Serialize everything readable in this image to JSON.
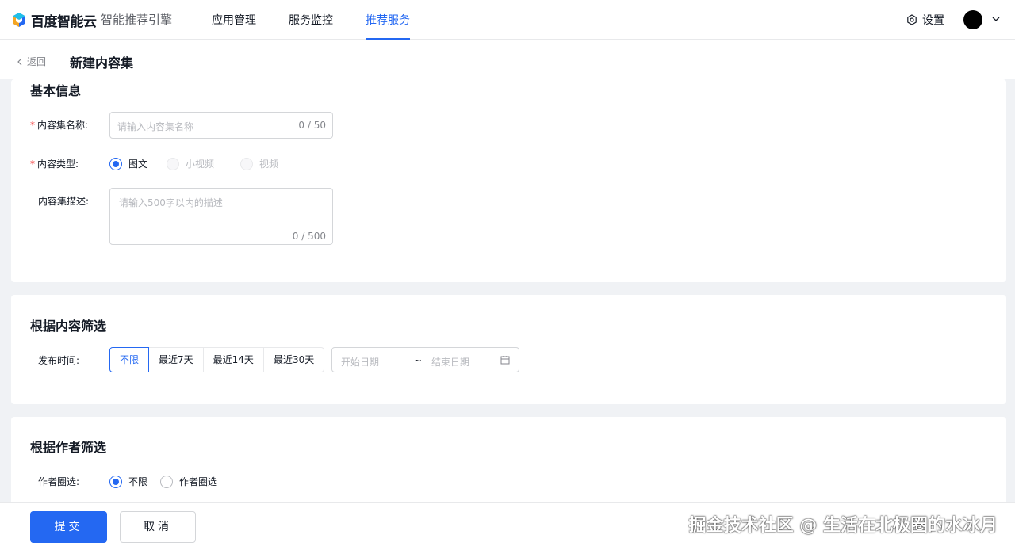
{
  "brand": {
    "logo_text": "百度智能云",
    "product_name": "智能推荐引擎"
  },
  "nav": {
    "items": [
      {
        "label": "应用管理",
        "active": false
      },
      {
        "label": "服务监控",
        "active": false
      },
      {
        "label": "推荐服务",
        "active": true
      }
    ],
    "settings_label": "设置"
  },
  "subheader": {
    "back_label": "返回",
    "title": "新建内容集"
  },
  "basic_info": {
    "title": "基本信息",
    "name_field": {
      "label": "内容集名称:",
      "required": true,
      "placeholder": "请输入内容集名称",
      "count": "0 / 50"
    },
    "type_field": {
      "label": "内容类型:",
      "required": true,
      "options": [
        {
          "label": "图文",
          "checked": true,
          "disabled": false
        },
        {
          "label": "小视频",
          "checked": false,
          "disabled": true
        },
        {
          "label": "视频",
          "checked": false,
          "disabled": true
        }
      ]
    },
    "desc_field": {
      "label": "内容集描述:",
      "required": false,
      "placeholder": "请输入500字以内的描述",
      "count": "0 / 500"
    }
  },
  "content_filter": {
    "title": "根据内容筛选",
    "publish_time_label": "发布时间:",
    "time_options": [
      "不限",
      "最近7天",
      "最近14天",
      "最近30天"
    ],
    "active_time_option": "不限",
    "start_placeholder": "开始日期",
    "separator": "~",
    "end_placeholder": "结束日期"
  },
  "author_filter": {
    "title": "根据作者筛选",
    "label": "作者圈选:",
    "options": [
      {
        "label": "不限",
        "checked": true
      },
      {
        "label": "作者圈选",
        "checked": false
      }
    ]
  },
  "footer": {
    "submit_label": "提交",
    "cancel_label": "取消"
  },
  "watermark": "掘金技术社区 @ 生活在北极圈的水冰月",
  "colors": {
    "primary": "#2468f2",
    "required": "#f33e3e",
    "background": "#f0f2f5"
  }
}
